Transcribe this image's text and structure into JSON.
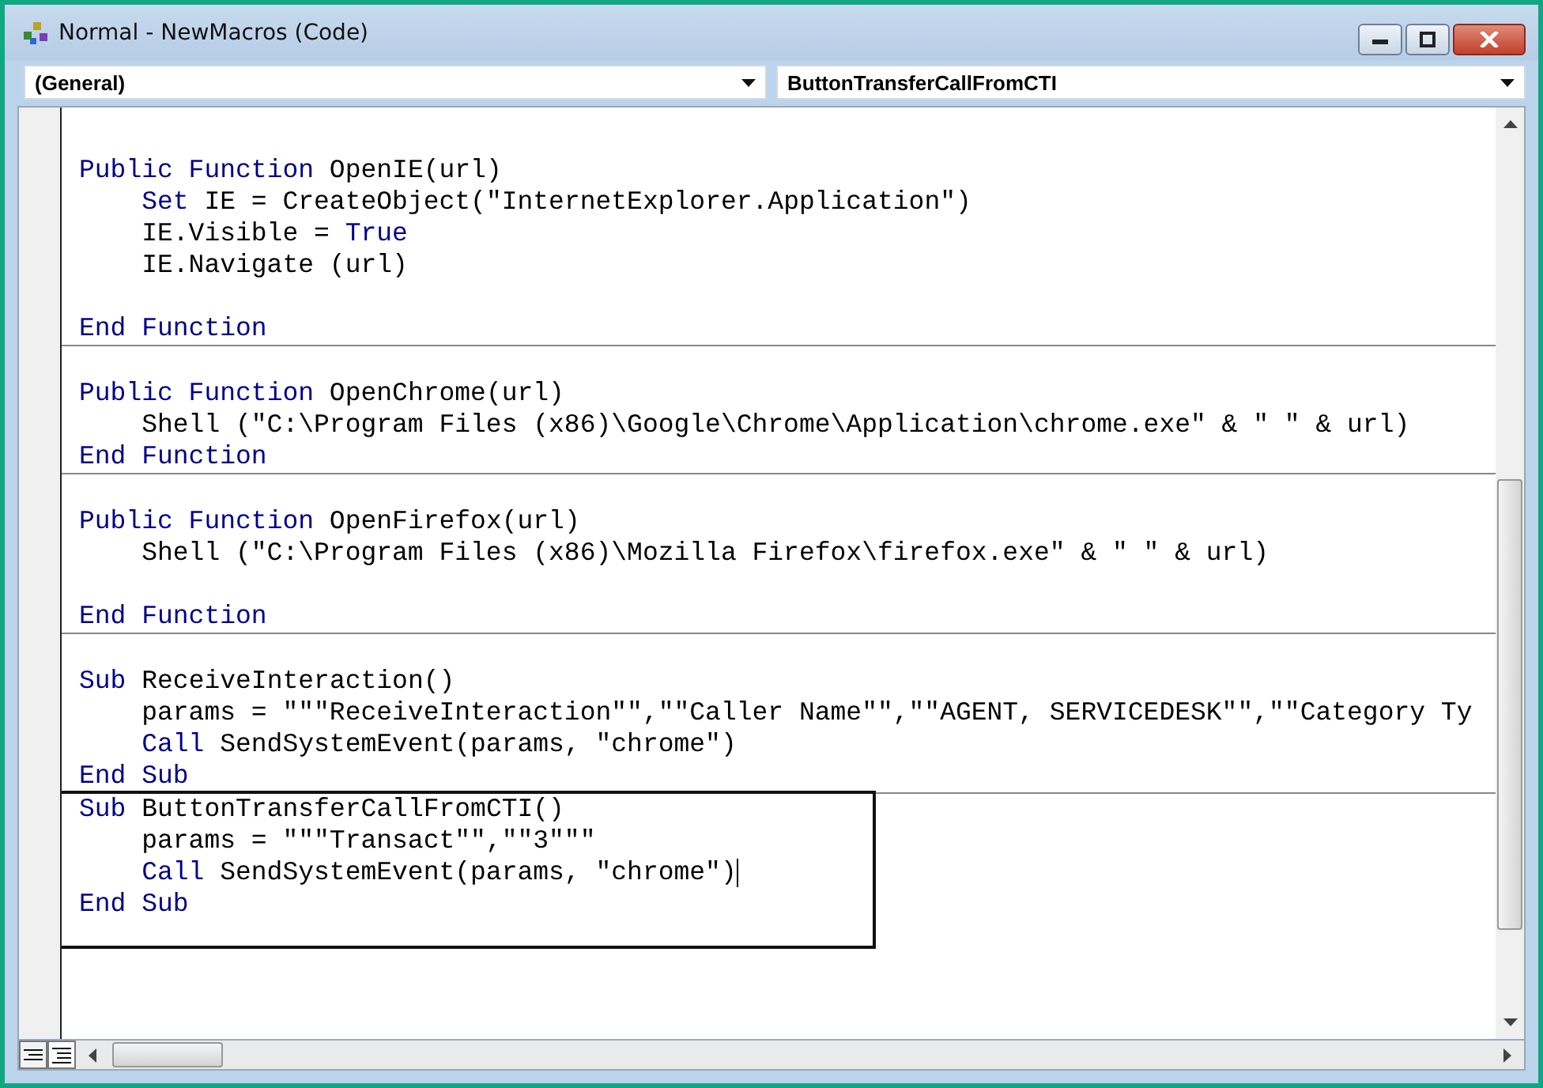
{
  "window": {
    "title": "Normal - NewMacros (Code)"
  },
  "object_dropdown": {
    "value": "(General)"
  },
  "procedure_dropdown": {
    "value": "ButtonTransferCallFromCTI"
  },
  "procedures": [
    {
      "highlighted": false,
      "lines": [
        {
          "kind": "blank"
        },
        {
          "kind": "code",
          "indented": false,
          "segments": [
            {
              "kind": "keyword",
              "text": "Public Function"
            },
            {
              "kind": "plain",
              "text": " OpenIE(url)"
            }
          ]
        },
        {
          "kind": "code",
          "indented": true,
          "segments": [
            {
              "kind": "keyword",
              "text": "Set"
            },
            {
              "kind": "plain",
              "text": " IE = CreateObject(\"InternetExplorer.Application\")"
            }
          ]
        },
        {
          "kind": "code",
          "indented": true,
          "segments": [
            {
              "kind": "plain",
              "text": "IE.Visible = "
            },
            {
              "kind": "keyword",
              "text": "True"
            }
          ]
        },
        {
          "kind": "code",
          "indented": true,
          "segments": [
            {
              "kind": "plain",
              "text": "IE.Navigate (url)"
            }
          ]
        },
        {
          "kind": "blank"
        },
        {
          "kind": "code",
          "indented": false,
          "segments": [
            {
              "kind": "keyword",
              "text": "End Function"
            }
          ]
        }
      ]
    },
    {
      "highlighted": false,
      "lines": [
        {
          "kind": "blank"
        },
        {
          "kind": "code",
          "indented": false,
          "segments": [
            {
              "kind": "keyword",
              "text": "Public Function"
            },
            {
              "kind": "plain",
              "text": " OpenChrome(url)"
            }
          ]
        },
        {
          "kind": "code",
          "indented": true,
          "segments": [
            {
              "kind": "plain",
              "text": "Shell (\"C:\\Program Files (x86)\\Google\\Chrome\\Application\\chrome.exe\" & \" \" & url)"
            }
          ]
        },
        {
          "kind": "code",
          "indented": false,
          "segments": [
            {
              "kind": "keyword",
              "text": "End Function"
            }
          ]
        }
      ]
    },
    {
      "highlighted": false,
      "lines": [
        {
          "kind": "blank"
        },
        {
          "kind": "code",
          "indented": false,
          "segments": [
            {
              "kind": "keyword",
              "text": "Public Function"
            },
            {
              "kind": "plain",
              "text": " OpenFirefox(url)"
            }
          ]
        },
        {
          "kind": "code",
          "indented": true,
          "segments": [
            {
              "kind": "plain",
              "text": "Shell (\"C:\\Program Files (x86)\\Mozilla Firefox\\firefox.exe\" & \" \" & url)"
            }
          ]
        },
        {
          "kind": "blank"
        },
        {
          "kind": "code",
          "indented": false,
          "segments": [
            {
              "kind": "keyword",
              "text": "End Function"
            }
          ]
        }
      ]
    },
    {
      "highlighted": false,
      "lines": [
        {
          "kind": "blank"
        },
        {
          "kind": "code",
          "indented": false,
          "segments": [
            {
              "kind": "keyword",
              "text": "Sub"
            },
            {
              "kind": "plain",
              "text": " ReceiveInteraction()"
            }
          ]
        },
        {
          "kind": "code",
          "indented": true,
          "segments": [
            {
              "kind": "plain",
              "text": "params = \"\"\"ReceiveInteraction\"\",\"\"Caller Name\"\",\"\"AGENT, SERVICEDESK\"\",\"\"Category Ty"
            }
          ]
        },
        {
          "kind": "code",
          "indented": true,
          "segments": [
            {
              "kind": "keyword",
              "text": "Call"
            },
            {
              "kind": "plain",
              "text": " SendSystemEvent(params, \"chrome\")"
            }
          ]
        },
        {
          "kind": "code",
          "indented": false,
          "segments": [
            {
              "kind": "keyword",
              "text": "End Sub"
            }
          ]
        }
      ]
    },
    {
      "highlighted": true,
      "lines": [
        {
          "kind": "code",
          "indented": false,
          "segments": [
            {
              "kind": "keyword",
              "text": "Sub"
            },
            {
              "kind": "plain",
              "text": " ButtonTransferCallFromCTI()"
            }
          ]
        },
        {
          "kind": "code",
          "indented": true,
          "segments": [
            {
              "kind": "plain",
              "text": "params = \"\"\"Transact\"\",\"\"3\"\"\""
            }
          ]
        },
        {
          "kind": "code",
          "indented": true,
          "caret": true,
          "segments": [
            {
              "kind": "keyword",
              "text": "Call"
            },
            {
              "kind": "plain",
              "text": " SendSystemEvent(params, \"chrome\")"
            }
          ]
        },
        {
          "kind": "code",
          "indented": false,
          "segments": [
            {
              "kind": "keyword",
              "text": "End Sub"
            }
          ]
        }
      ]
    }
  ]
}
